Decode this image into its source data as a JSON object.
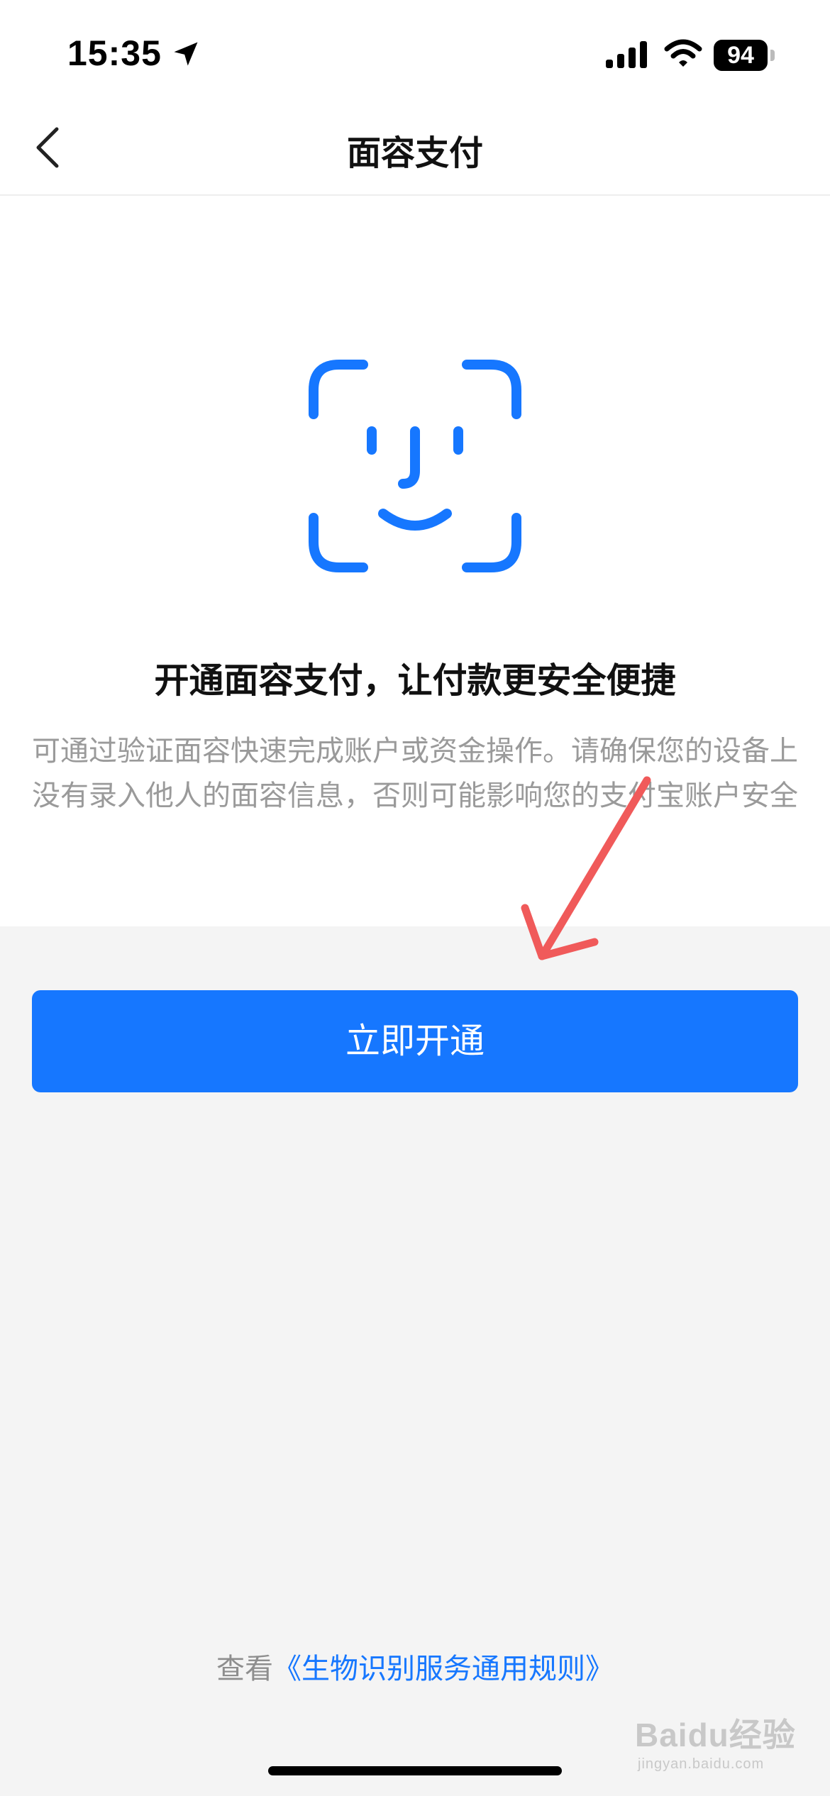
{
  "status_bar": {
    "time": "15:35",
    "battery_level": "94",
    "icons": [
      "location-icon",
      "signal-icon",
      "wifi-icon",
      "battery-icon"
    ]
  },
  "nav": {
    "title": "面容支付",
    "back_icon": "chevron-left-icon"
  },
  "hero": {
    "icon": "face-id-icon",
    "title": "开通面容支付，让付款更安全便捷",
    "description": "可通过验证面容快速完成账户或资金操作。请确保您的设备上没有录入他人的面容信息，否则可能影响您的支付宝账户安全"
  },
  "actions": {
    "open_button_label": "立即开通"
  },
  "agreement": {
    "prefix": "查看",
    "link_text": "《生物识别服务通用规则》"
  },
  "watermark": {
    "brand": "Baidu经验",
    "sub": "jingyan.baidu.com"
  },
  "colors": {
    "accent": "#1677ff",
    "annotation_arrow": "#f05a5a",
    "description_text": "#9a9a9a",
    "page_background": "#f4f4f4"
  }
}
